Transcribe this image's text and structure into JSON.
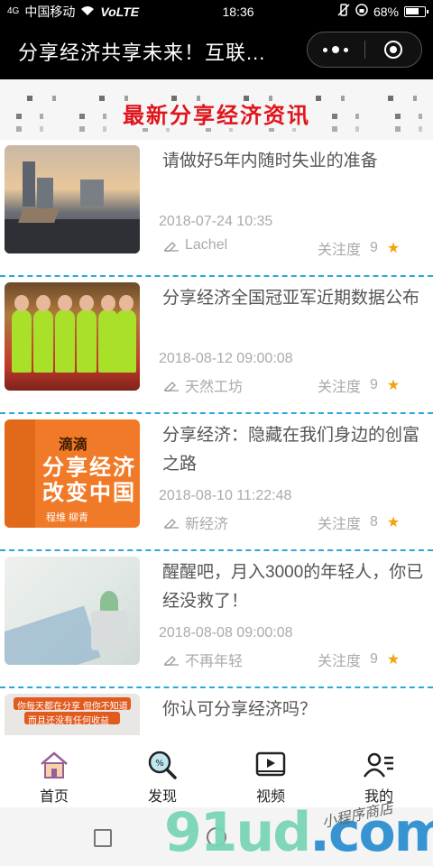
{
  "status_bar": {
    "signal": "4G",
    "carrier": "中国移动",
    "network": "VoLTE",
    "time": "18:36",
    "battery": "68%"
  },
  "nav": {
    "title": "分享经济共享未来！互联..."
  },
  "banner": {
    "title": "最新分享经济资讯"
  },
  "articles": [
    {
      "title": "请做好5年内随时失业的准备",
      "date": "2018-07-24 10:35",
      "author": "Lachel",
      "hot_label": "关注度",
      "hot": "9"
    },
    {
      "title": "分享经济全国冠亚军近期数据公布",
      "date": "2018-08-12 09:00:08",
      "author": "天然工坊",
      "hot_label": "关注度",
      "hot": "9"
    },
    {
      "title": "分享经济：隐藏在我们身边的创富之路",
      "date": "2018-08-10 11:22:48",
      "author": "新经济",
      "hot_label": "关注度",
      "hot": "8"
    },
    {
      "title": "醒醒吧，月入3000的年轻人，你已经没救了！",
      "date": "2018-08-08 09:00:08",
      "author": "不再年轻",
      "hot_label": "关注度",
      "hot": "9"
    },
    {
      "title": "你认可分享经济吗？"
    }
  ],
  "book_cover": {
    "top": "滴滴",
    "line1": "分享经济",
    "line2": "改变中国",
    "authors": "程维 柳青"
  },
  "promo_cover": {
    "line1": "你每天都在分享 但你不知道",
    "line2": "而且还没有任何收益"
  },
  "tabs": [
    {
      "label": "首页",
      "icon": "home-icon"
    },
    {
      "label": "发现",
      "icon": "discover-icon"
    },
    {
      "label": "视频",
      "icon": "video-icon"
    },
    {
      "label": "我的",
      "icon": "profile-icon"
    }
  ],
  "watermark": {
    "brand": "91ud",
    "suffix": ".com",
    "script": "小程序商店"
  },
  "colors": {
    "accent_red": "#e0151c",
    "divider_blue": "#29a9d8",
    "star": "#f0a30a"
  }
}
